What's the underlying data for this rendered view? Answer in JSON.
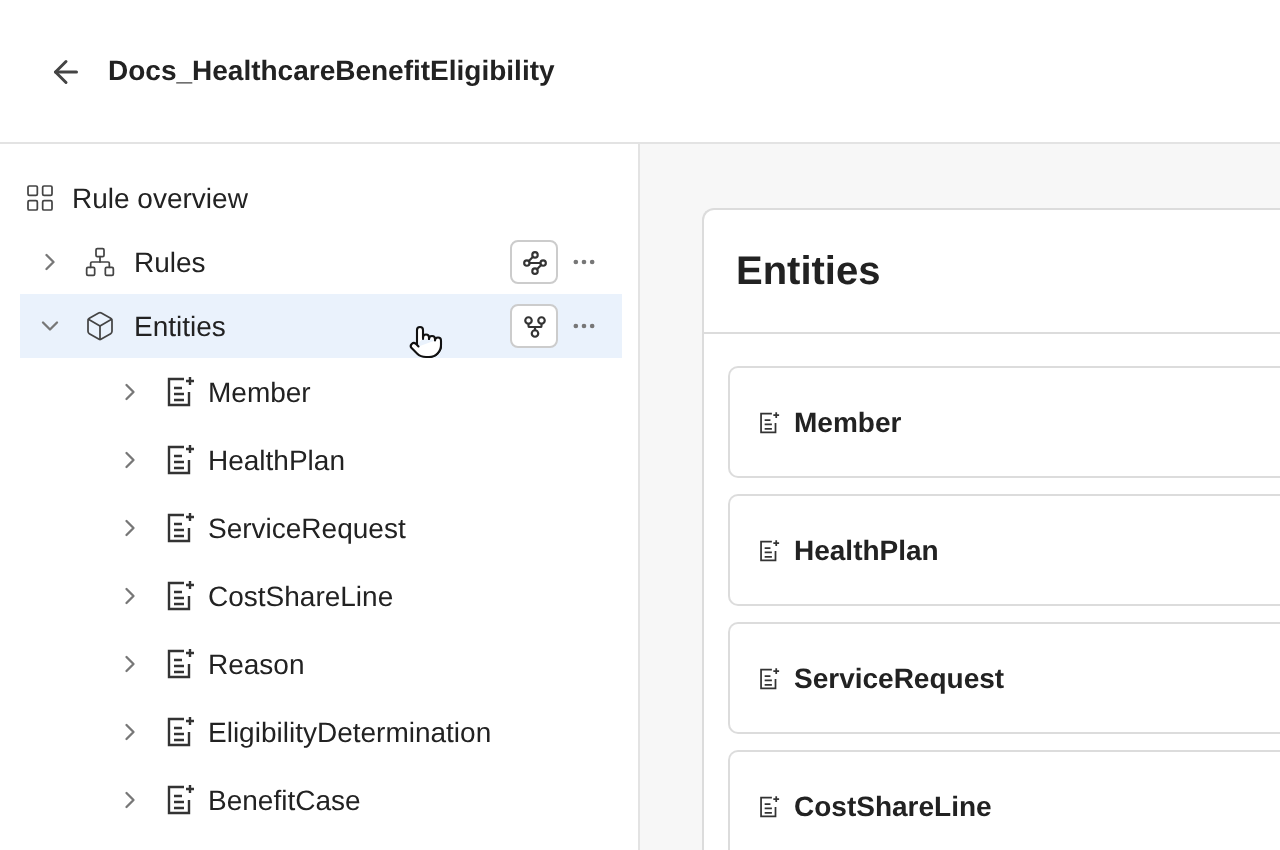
{
  "header": {
    "title": "Docs_HealthcareBenefitEligibility"
  },
  "sidebar": {
    "items": [
      {
        "label": "Rule overview",
        "kind": "overview"
      },
      {
        "label": "Rules",
        "kind": "rules",
        "expanded": false,
        "selected": false
      },
      {
        "label": "Entities",
        "kind": "entities",
        "expanded": true,
        "selected": true,
        "children": [
          {
            "label": "Member",
            "expanded": false
          },
          {
            "label": "HealthPlan",
            "expanded": false
          },
          {
            "label": "ServiceRequest",
            "expanded": false
          },
          {
            "label": "CostShareLine",
            "expanded": false
          },
          {
            "label": "Reason",
            "expanded": false
          },
          {
            "label": "EligibilityDetermination",
            "expanded": false
          },
          {
            "label": "BenefitCase",
            "expanded": false
          }
        ]
      }
    ]
  },
  "main": {
    "title": "Entities",
    "cards": [
      "Member",
      "HealthPlan",
      "ServiceRequest",
      "CostShareLine"
    ]
  }
}
